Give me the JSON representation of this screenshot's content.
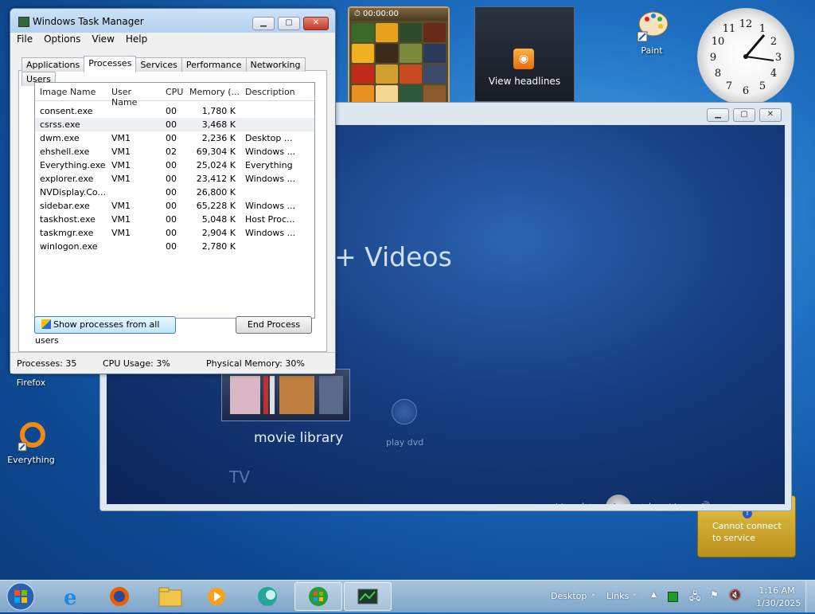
{
  "desktop": {
    "icons": [
      {
        "label": "Paint",
        "icon": "paint-palette-icon"
      },
      {
        "label": "Firefox",
        "icon": "firefox-icon"
      },
      {
        "label": "Everything",
        "icon": "everything-icon"
      }
    ]
  },
  "gadgets": {
    "puzzle_timer": "00:00:00",
    "feed_text": "View headlines",
    "weather_line1": "Cannot connect",
    "weather_line2": "to service",
    "clock_numbers": [
      "12",
      "1",
      "2",
      "3",
      "4",
      "5",
      "6",
      "7",
      "8",
      "9",
      "10",
      "11"
    ]
  },
  "media_center": {
    "section_text": "+ Videos",
    "movie_library": "movie library",
    "play_dvd": "play dvd",
    "tv": "TV",
    "transport": [
      "●",
      "☰",
      "−",
      "+",
      "■",
      "◀◀",
      "|◀",
      "▶",
      "▶|",
      "▶▶",
      "🔊",
      "−",
      "+"
    ]
  },
  "task_manager": {
    "title": "Windows Task Manager",
    "menu": [
      "File",
      "Options",
      "View",
      "Help"
    ],
    "tabs": [
      "Applications",
      "Processes",
      "Services",
      "Performance",
      "Networking",
      "Users"
    ],
    "active_tab": "Processes",
    "columns": [
      "Image Name",
      "User Name",
      "CPU",
      "Memory (...",
      "Description"
    ],
    "rows": [
      {
        "name": "consent.exe",
        "user": "",
        "cpu": "00",
        "mem": "1,780 K",
        "desc": ""
      },
      {
        "name": "csrss.exe",
        "user": "",
        "cpu": "00",
        "mem": "3,468 K",
        "desc": ""
      },
      {
        "name": "dwm.exe",
        "user": "VM1",
        "cpu": "00",
        "mem": "2,236 K",
        "desc": "Desktop ..."
      },
      {
        "name": "ehshell.exe",
        "user": "VM1",
        "cpu": "02",
        "mem": "69,304 K",
        "desc": "Windows ..."
      },
      {
        "name": "Everything.exe",
        "user": "VM1",
        "cpu": "00",
        "mem": "25,024 K",
        "desc": "Everything"
      },
      {
        "name": "explorer.exe",
        "user": "VM1",
        "cpu": "00",
        "mem": "23,412 K",
        "desc": "Windows ..."
      },
      {
        "name": "NVDisplay.Co...",
        "user": "",
        "cpu": "00",
        "mem": "26,800 K",
        "desc": ""
      },
      {
        "name": "sidebar.exe",
        "user": "VM1",
        "cpu": "00",
        "mem": "65,228 K",
        "desc": "Windows ..."
      },
      {
        "name": "taskhost.exe",
        "user": "VM1",
        "cpu": "00",
        "mem": "5,048 K",
        "desc": "Host Proc..."
      },
      {
        "name": "taskmgr.exe",
        "user": "VM1",
        "cpu": "00",
        "mem": "2,904 K",
        "desc": "Windows ..."
      },
      {
        "name": "winlogon.exe",
        "user": "",
        "cpu": "00",
        "mem": "2,780 K",
        "desc": ""
      }
    ],
    "show_all_button": "Show processes from all users",
    "end_process_button": "End Process",
    "status": {
      "processes": "Processes: 35",
      "cpu": "CPU Usage: 3%",
      "memory": "Physical Memory: 30%"
    }
  },
  "taskbar": {
    "desktop_label": "Desktop",
    "links_label": "Links",
    "time": "1:16 AM",
    "date": "1/30/2025"
  },
  "colors": {
    "accent": "#1e6fc2",
    "taskbar": "#8fb1d2",
    "mc_background": "#163d7f"
  }
}
